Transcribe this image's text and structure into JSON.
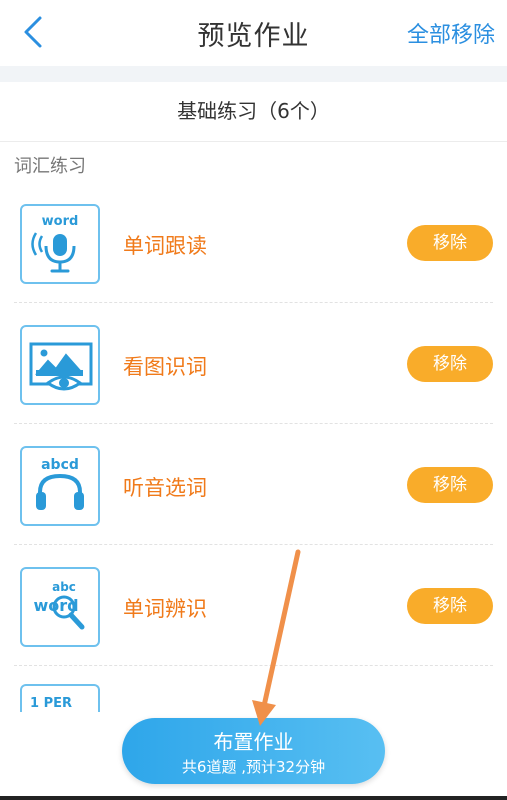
{
  "header": {
    "title": "预览作业",
    "remove_all_label": "全部移除",
    "back_icon": "chevron-left-icon"
  },
  "section": {
    "title": "基础练习（6个）",
    "group_label": "词汇练习"
  },
  "exercises": [
    {
      "label": "单词跟读",
      "icon": "word-microphone-icon",
      "icon_text": "word",
      "remove_label": "移除"
    },
    {
      "label": "看图识词",
      "icon": "picture-eye-icon",
      "icon_text": "",
      "remove_label": "移除"
    },
    {
      "label": "听音选词",
      "icon": "abcd-headphones-icon",
      "icon_text": "abcd",
      "remove_label": "移除"
    },
    {
      "label": "单词辨识",
      "icon": "abc-word-magnifier-icon",
      "icon_text_top": "abc",
      "icon_text": "word",
      "remove_label": "移除"
    }
  ],
  "partial_item": {
    "icon_text": "1 PER"
  },
  "assign_button": {
    "label": "布置作业",
    "summary": "共6道题 ,预计32分钟"
  },
  "colors": {
    "accent_blue": "#2b8fe0",
    "item_label_orange": "#f07a1a",
    "remove_button_orange": "#f9ac2a",
    "icon_border_blue": "#6ec1ee",
    "annotation_arrow": "#f0904a"
  }
}
